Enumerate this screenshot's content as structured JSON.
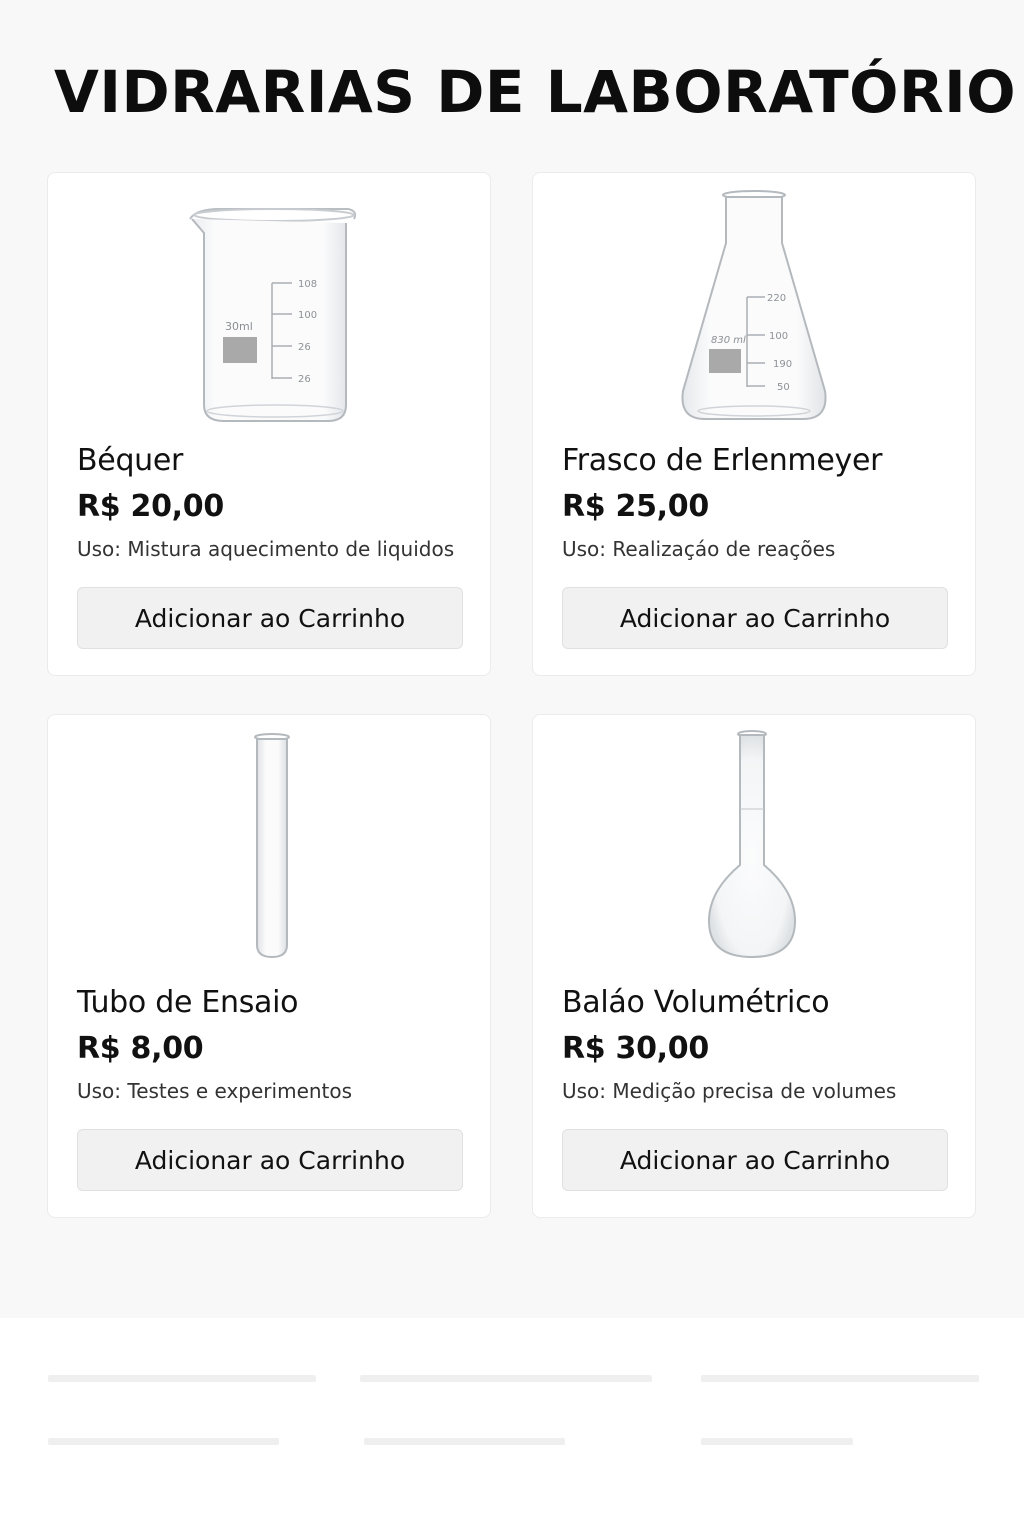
{
  "page": {
    "title": "VIDRARIAS DE LABORATÓRIO"
  },
  "products": [
    {
      "name": "Béquer",
      "price": "R$ 20,00",
      "use": "Uso: Mistura aquecimento de liquidos",
      "button_label": "Adicionar ao Carrinho",
      "image": {
        "icon": "beaker-icon",
        "volume_label": "30ml",
        "scale_labels": [
          "108",
          "100",
          "26",
          "26"
        ]
      }
    },
    {
      "name": "Frasco de Erlenmeyer",
      "price": "R$ 25,00",
      "use": "Uso: Realizaçáo de reações",
      "button_label": "Adicionar ao Carrinho",
      "image": {
        "icon": "erlenmeyer-flask-icon",
        "volume_label": "830 ml",
        "scale_labels": [
          "220",
          "100",
          "190",
          "50"
        ]
      }
    },
    {
      "name": "Tubo de Ensaio",
      "price": "R$ 8,00",
      "use": "Uso: Testes e experimentos",
      "button_label": "Adicionar ao Carrinho",
      "image": {
        "icon": "test-tube-icon"
      }
    },
    {
      "name": "Baláo Volumétrico",
      "price": "R$ 30,00",
      "use": "Uso: Medição precisa de volumes",
      "button_label": "Adicionar ao Carrinho",
      "image": {
        "icon": "volumetric-flask-icon"
      }
    }
  ],
  "colors": {
    "background": "#f8f8f8",
    "card": "#ffffff",
    "button": "#f1f1f1",
    "text": "#111111"
  }
}
